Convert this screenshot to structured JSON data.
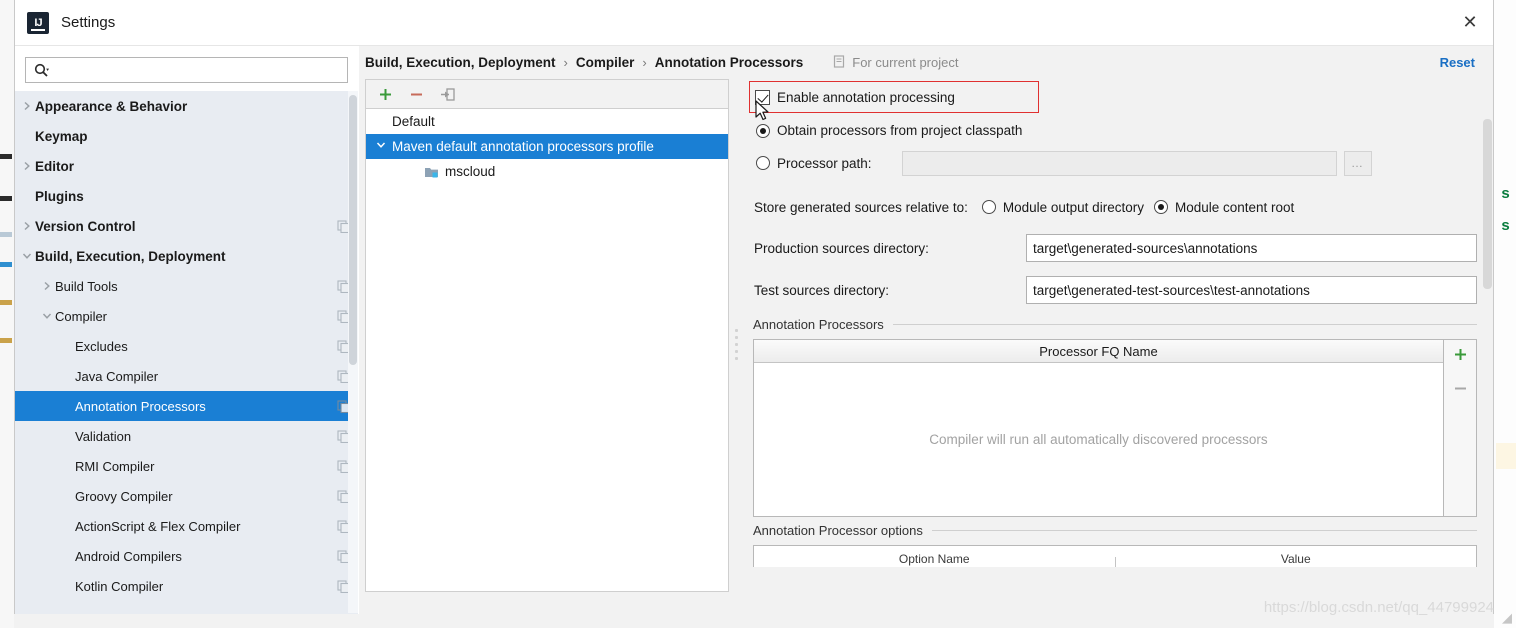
{
  "window": {
    "title": "Settings",
    "app_icon": "intellij-idea-icon",
    "close_label": "✕"
  },
  "search": {
    "value": "",
    "placeholder": "",
    "icon": "search-icon"
  },
  "sidebar": {
    "items": [
      {
        "label": "Appearance & Behavior",
        "level": 0,
        "twisty": "collapsed",
        "copy": false,
        "selected": false
      },
      {
        "label": "Keymap",
        "level": 0,
        "twisty": "none",
        "copy": false,
        "selected": false
      },
      {
        "label": "Editor",
        "level": 0,
        "twisty": "collapsed",
        "copy": false,
        "selected": false
      },
      {
        "label": "Plugins",
        "level": 0,
        "twisty": "none",
        "copy": false,
        "selected": false
      },
      {
        "label": "Version Control",
        "level": 0,
        "twisty": "collapsed",
        "copy": true,
        "selected": false
      },
      {
        "label": "Build, Execution, Deployment",
        "level": 0,
        "twisty": "expanded",
        "copy": false,
        "selected": false
      },
      {
        "label": "Build Tools",
        "level": 1,
        "twisty": "collapsed",
        "copy": true,
        "selected": false
      },
      {
        "label": "Compiler",
        "level": 1,
        "twisty": "expanded",
        "copy": true,
        "selected": false
      },
      {
        "label": "Excludes",
        "level": 2,
        "twisty": "none",
        "copy": true,
        "selected": false
      },
      {
        "label": "Java Compiler",
        "level": 2,
        "twisty": "none",
        "copy": true,
        "selected": false
      },
      {
        "label": "Annotation Processors",
        "level": 2,
        "twisty": "none",
        "copy": true,
        "selected": true
      },
      {
        "label": "Validation",
        "level": 2,
        "twisty": "none",
        "copy": true,
        "selected": false
      },
      {
        "label": "RMI Compiler",
        "level": 2,
        "twisty": "none",
        "copy": true,
        "selected": false
      },
      {
        "label": "Groovy Compiler",
        "level": 2,
        "twisty": "none",
        "copy": true,
        "selected": false
      },
      {
        "label": "ActionScript & Flex Compiler",
        "level": 2,
        "twisty": "none",
        "copy": true,
        "selected": false
      },
      {
        "label": "Android Compilers",
        "level": 2,
        "twisty": "none",
        "copy": true,
        "selected": false
      },
      {
        "label": "Kotlin Compiler",
        "level": 2,
        "twisty": "none",
        "copy": true,
        "selected": false
      }
    ]
  },
  "breadcrumb": {
    "parts": [
      "Build, Execution, Deployment",
      "Compiler",
      "Annotation Processors"
    ],
    "separator": "›",
    "scope_label": "For current project",
    "scope_icon": "project-scope-icon",
    "reset_label": "Reset"
  },
  "profiles": {
    "toolbar": {
      "add_label": "+",
      "remove_label": "−",
      "move_label": "move-to-icon"
    },
    "rows": [
      {
        "label": "Default",
        "twisty": "none",
        "indent": 0,
        "selected": false,
        "icon": "none"
      },
      {
        "label": "Maven default annotation processors profile",
        "twisty": "expanded",
        "indent": 0,
        "selected": true,
        "icon": "none"
      },
      {
        "label": "mscloud",
        "twisty": "none",
        "indent": 1,
        "selected": false,
        "icon": "module-icon"
      }
    ]
  },
  "settings": {
    "enable_processing": {
      "label": "Enable annotation processing",
      "checked": true
    },
    "highlight_color": "#e03131",
    "source_mode": {
      "obtain_from_classpath": {
        "label": "Obtain processors from project classpath",
        "selected": true
      },
      "processor_path": {
        "label": "Processor path:",
        "selected": false,
        "value": "",
        "browse_label": "…"
      }
    },
    "store_relative": {
      "label": "Store generated sources relative to:",
      "options": [
        {
          "label": "Module output directory",
          "selected": false
        },
        {
          "label": "Module content root",
          "selected": true
        }
      ]
    },
    "production_dir": {
      "label": "Production sources directory:",
      "value": "target\\generated-sources\\annotations"
    },
    "test_dir": {
      "label": "Test sources directory:",
      "value": "target\\generated-test-sources\\test-annotations"
    },
    "processors_group": {
      "title": "Annotation Processors",
      "column_header": "Processor FQ Name",
      "empty_text": "Compiler will run all automatically discovered processors",
      "add_label": "+",
      "remove_label": "−",
      "rows": []
    },
    "options_group": {
      "title": "Annotation Processor options",
      "column_headers": [
        "Option Name",
        "Value"
      ],
      "rows": []
    }
  },
  "watermark": {
    "text": "https://blog.csdn.net/qq_44799924"
  },
  "colors": {
    "selection_blue": "#1a7fd4",
    "link_blue": "#1a6fc4",
    "highlight_red": "#e03131",
    "sidebar_bg": "#e8ecf2",
    "panel_bg": "#f2f2f2",
    "accent_green": "#3a9a3a"
  }
}
